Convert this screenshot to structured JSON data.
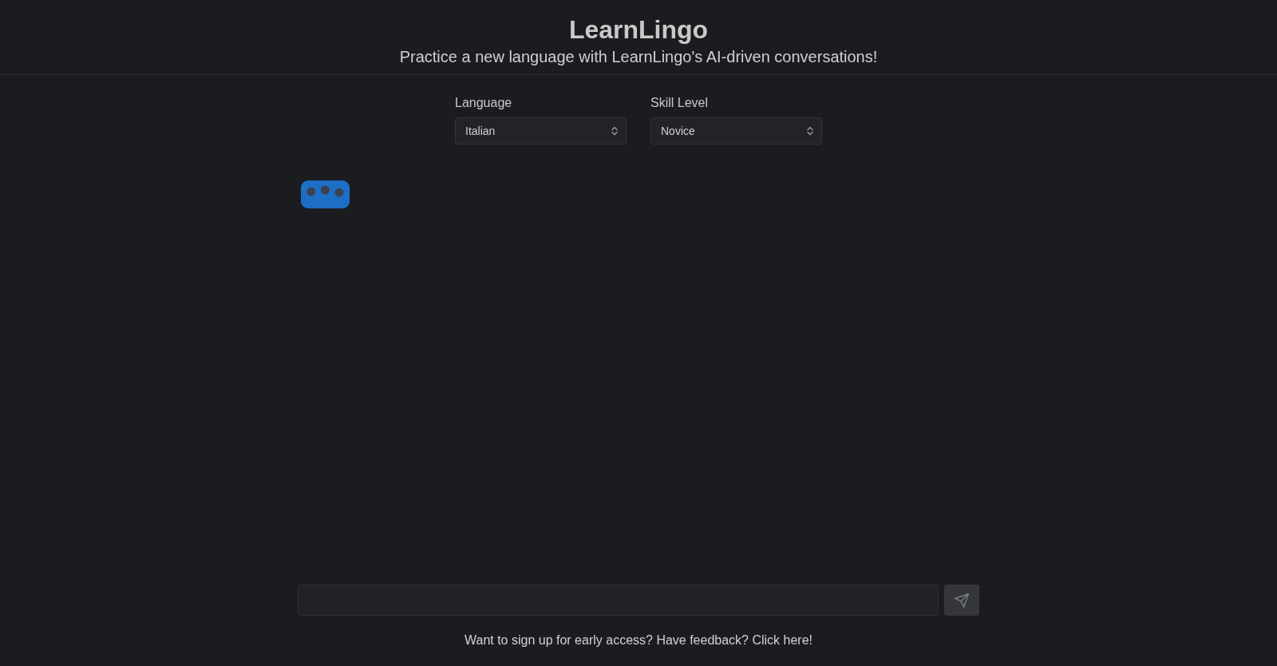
{
  "header": {
    "title": "LearnLingo",
    "subtitle": "Practice a new language with LearnLingo's AI-driven conversations!"
  },
  "settings": [
    {
      "label": "Language",
      "value": "Italian"
    },
    {
      "label": "Skill Level",
      "value": "Novice"
    }
  ],
  "chat": {
    "typing": true
  },
  "composer": {
    "send_disabled": true
  },
  "footer": {
    "text": "Want to sign up for early access? Have feedback? Click here!"
  }
}
